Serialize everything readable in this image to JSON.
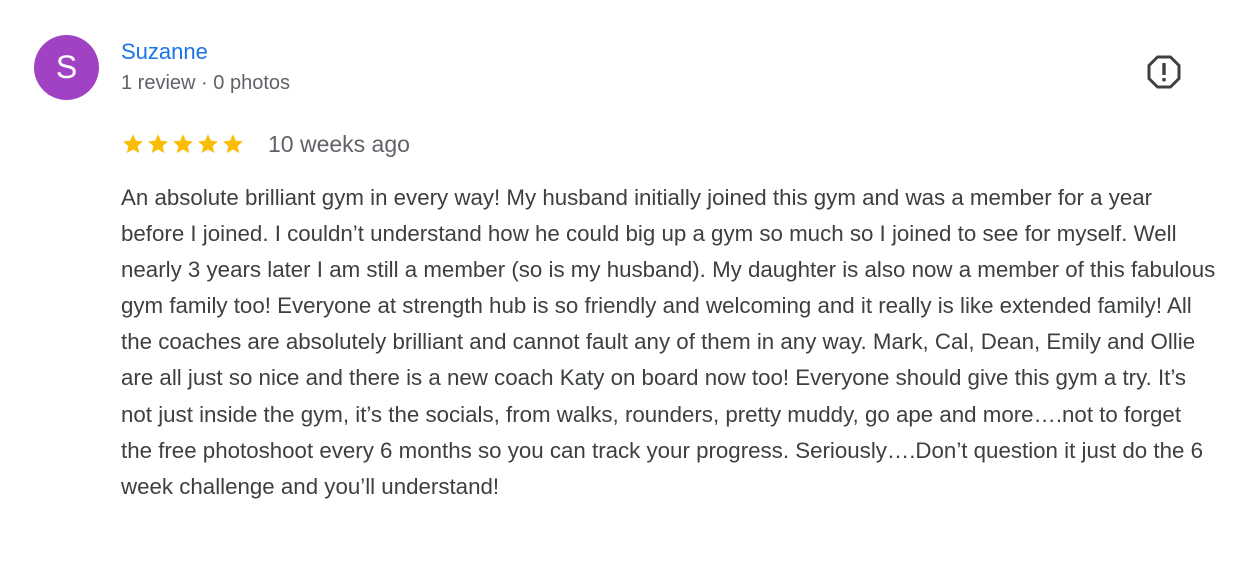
{
  "review": {
    "author_initial": "S",
    "author_name": "Suzanne",
    "review_count": "1 review",
    "separator": "·",
    "photo_count": "0 photos",
    "rating": 5,
    "max_rating": 5,
    "time_ago": "10 weeks ago",
    "text": "An absolute brilliant gym in every way! My husband initially joined this gym and was a member for a year before I joined. I couldn’t understand how he could big up a gym so much so I joined to see for myself. Well nearly 3 years later I am still a member (so is my husband). My daughter is also now a member of this fabulous gym family too! Everyone at strength hub is so friendly and welcoming and it really is like extended family! All the coaches are absolutely brilliant and cannot fault any of them in any way. Mark, Cal, Dean, Emily and Ollie are all just so nice and there is a new coach Katy on board now too! Everyone should give this gym a try. It’s not just inside the gym, it’s the socials, from walks, rounders, pretty muddy, go ape and more….not to forget the free photoshoot every 6 months so you can track your progress. Seriously….Don’t question it just do the 6 week challenge and you’ll understand!"
  },
  "icons": {
    "flag": "report-icon",
    "star": "star-icon"
  },
  "colors": {
    "avatar_bg": "#a142c4",
    "name": "#1a73e8",
    "star": "#fbbc04",
    "meta": "#5f6368",
    "text": "#3c4043",
    "flag": "#3c4043"
  }
}
